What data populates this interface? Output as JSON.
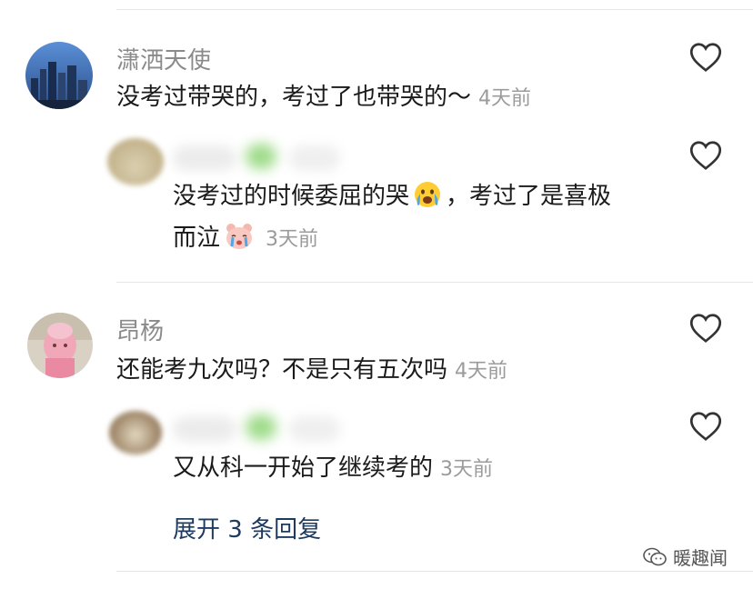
{
  "comments": [
    {
      "username": "潇洒天使",
      "text": "没考过带哭的，考过了也带哭的～",
      "time": "4天前",
      "reply": {
        "text_line1": "没考过的时候委屈的哭",
        "text_line1_after": "，考过了是喜极",
        "text_line2": "而泣",
        "time": "3天前",
        "emoji1": "crying-face-emoji",
        "emoji2": "teary-bear-emoji"
      }
    },
    {
      "username": "昂杨",
      "text": "还能考九次吗？不是只有五次吗",
      "time": "4天前",
      "reply": {
        "text_line1": "又从科一开始了继续考的",
        "time": "3天前"
      }
    }
  ],
  "expand_replies": "展开 3 条回复",
  "watermark": "暖趣闻",
  "colors": {
    "link": "#1e3a5f",
    "username": "#8a8a8a",
    "time": "#9b9b9b"
  }
}
